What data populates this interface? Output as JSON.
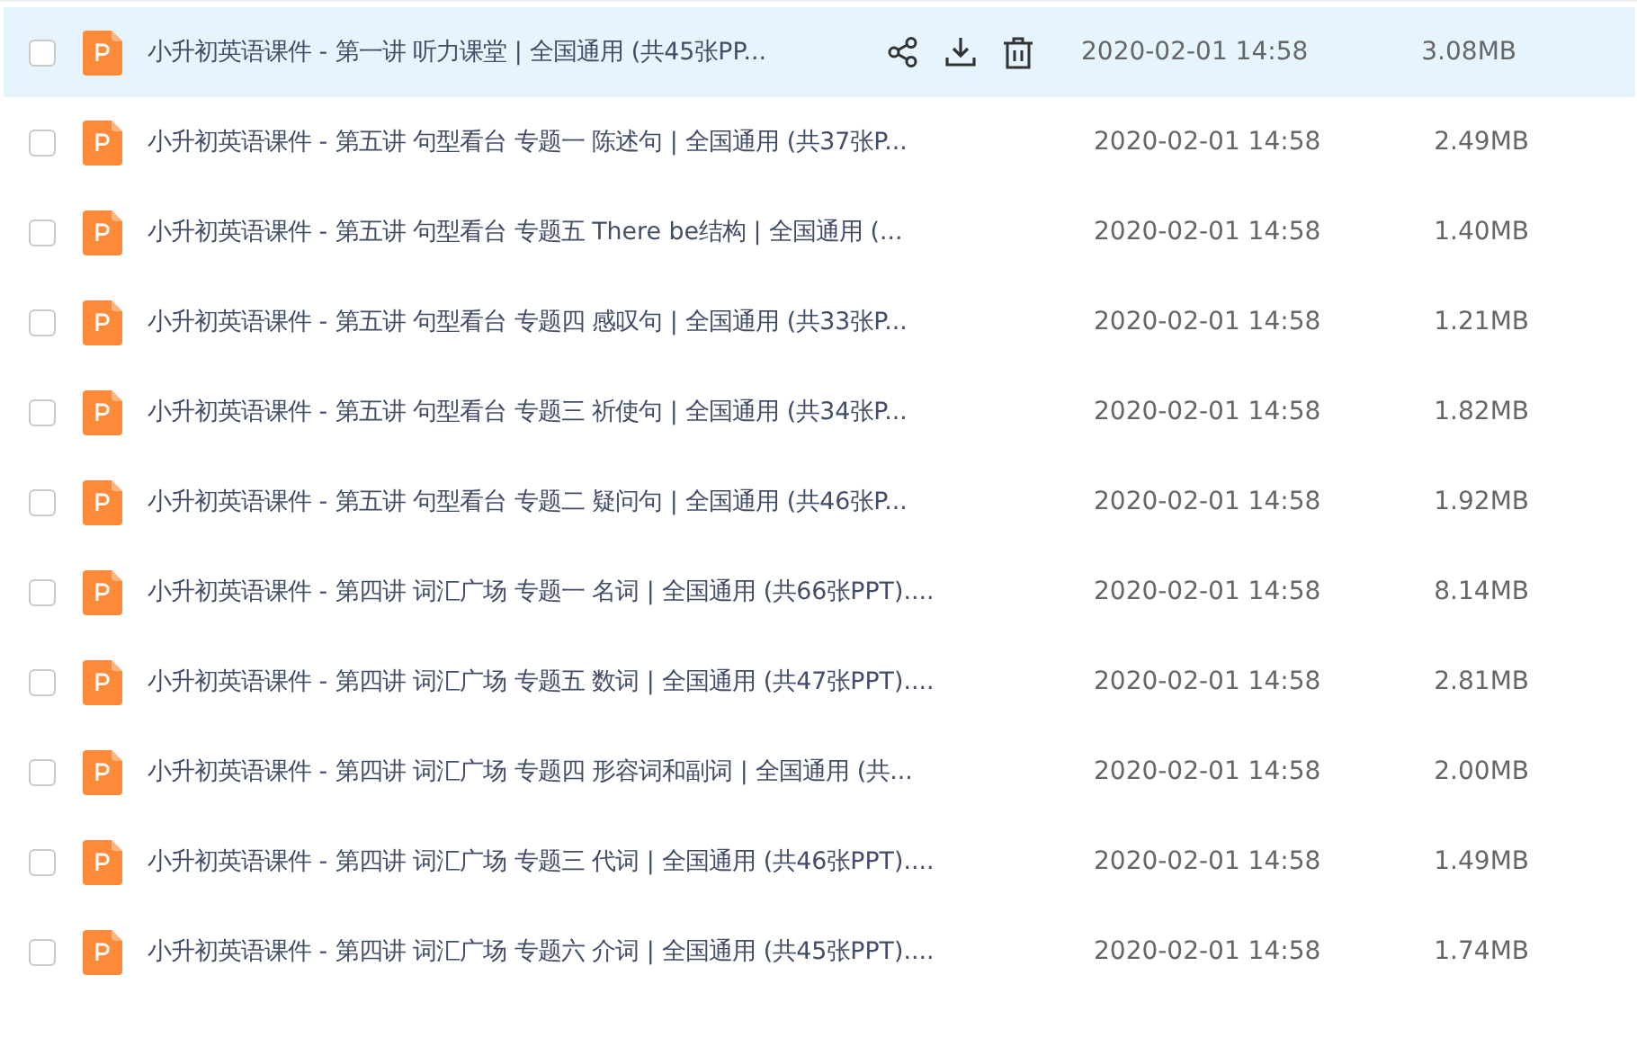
{
  "files": [
    {
      "name": "小升初英语课件 - 第一讲   听力课堂 | 全国通用 (共45张PP...",
      "date": "2020-02-01 14:58",
      "size": "3.08MB",
      "selected": true,
      "checked": false
    },
    {
      "name": "小升初英语课件 - 第五讲   句型看台 专题一   陈述句 | 全国通用 (共37张P...",
      "date": "2020-02-01 14:58",
      "size": "2.49MB",
      "selected": false,
      "checked": false
    },
    {
      "name": "小升初英语课件 - 第五讲   句型看台 专题五   There be结构 | 全国通用 (...",
      "date": "2020-02-01 14:58",
      "size": "1.40MB",
      "selected": false,
      "checked": false
    },
    {
      "name": "小升初英语课件 - 第五讲   句型看台 专题四   感叹句 | 全国通用 (共33张P...",
      "date": "2020-02-01 14:58",
      "size": "1.21MB",
      "selected": false,
      "checked": false
    },
    {
      "name": "小升初英语课件 - 第五讲   句型看台 专题三   祈使句 | 全国通用 (共34张P...",
      "date": "2020-02-01 14:58",
      "size": "1.82MB",
      "selected": false,
      "checked": false
    },
    {
      "name": "小升初英语课件 - 第五讲   句型看台 专题二   疑问句 | 全国通用 (共46张P...",
      "date": "2020-02-01 14:58",
      "size": "1.92MB",
      "selected": false,
      "checked": false
    },
    {
      "name": "小升初英语课件 - 第四讲 词汇广场 专题一   名词 | 全国通用 (共66张PPT)....",
      "date": "2020-02-01 14:58",
      "size": "8.14MB",
      "selected": false,
      "checked": false
    },
    {
      "name": "小升初英语课件 - 第四讲 词汇广场 专题五   数词 | 全国通用 (共47张PPT)....",
      "date": "2020-02-01 14:58",
      "size": "2.81MB",
      "selected": false,
      "checked": false
    },
    {
      "name": "小升初英语课件 - 第四讲 词汇广场 专题四   形容词和副词 | 全国通用 (共...",
      "date": "2020-02-01 14:58",
      "size": "2.00MB",
      "selected": false,
      "checked": false
    },
    {
      "name": "小升初英语课件 - 第四讲 词汇广场 专题三   代词 | 全国通用 (共46张PPT)....",
      "date": "2020-02-01 14:58",
      "size": "1.49MB",
      "selected": false,
      "checked": false
    },
    {
      "name": "小升初英语课件 - 第四讲 词汇广场 专题六   介词 | 全国通用 (共45张PPT)....",
      "date": "2020-02-01 14:58",
      "size": "1.74MB",
      "selected": false,
      "checked": false
    }
  ]
}
